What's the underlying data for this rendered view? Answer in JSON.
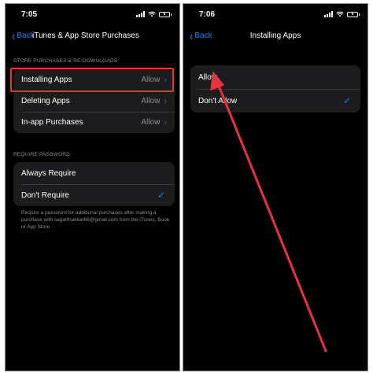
{
  "left": {
    "time": "7:05",
    "battery": "6",
    "back_label": "Back",
    "title": "iTunes & App Store Purchases",
    "section1_header": "STORE PURCHASES & RE-DOWNLOADS",
    "rows": [
      {
        "label": "Installing Apps",
        "value": "Allow"
      },
      {
        "label": "Deleting Apps",
        "value": "Allow"
      },
      {
        "label": "In-app Purchases",
        "value": "Allow"
      }
    ],
    "section2_header": "REQUIRE PASSWORD",
    "options": [
      {
        "label": "Always Require"
      },
      {
        "label": "Don't Require",
        "checked": true
      }
    ],
    "footer": "Require a password for additional purchases after making a purchase with sagarthakkar66@gmail.com from the iTunes, Book or App Store."
  },
  "right": {
    "time": "7:06",
    "battery": "6",
    "back_label": "Back",
    "title": "Installing Apps",
    "options": [
      {
        "label": "Allow"
      },
      {
        "label": "Don't Allow",
        "checked": true
      }
    ]
  },
  "colors": {
    "accent": "#0a84ff",
    "annotation": "#e8323c",
    "cell_bg": "#1c1c1e"
  },
  "icons": [
    "signal-icon",
    "wifi-icon",
    "battery-icon",
    "back-chevron-icon",
    "disclosure-chevron-icon",
    "checkmark-icon"
  ]
}
